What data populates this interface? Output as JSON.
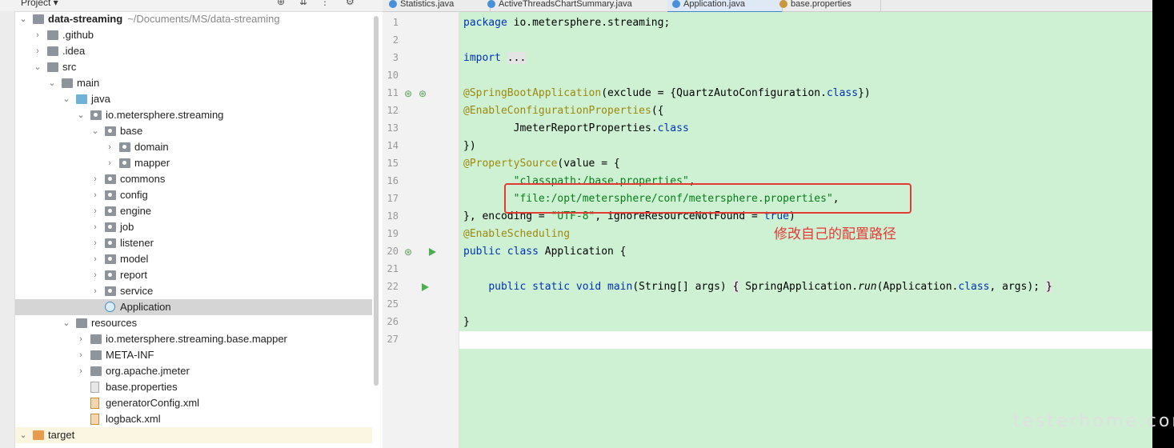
{
  "project_bar": {
    "label": "Project ▾"
  },
  "tree": [
    {
      "label": "data-streaming",
      "sub": "~/Documents/MS/data-streaming",
      "depth": 0,
      "arrow": "open",
      "icon": "folder",
      "bold": true
    },
    {
      "label": ".github",
      "depth": 1,
      "arrow": "closed",
      "icon": "folder"
    },
    {
      "label": ".idea",
      "depth": 1,
      "arrow": "closed",
      "icon": "folder"
    },
    {
      "label": "src",
      "depth": 1,
      "arrow": "open",
      "icon": "folder"
    },
    {
      "label": "main",
      "depth": 2,
      "arrow": "open",
      "icon": "folder"
    },
    {
      "label": "java",
      "depth": 3,
      "arrow": "open",
      "icon": "folder-blue"
    },
    {
      "label": "io.metersphere.streaming",
      "depth": 4,
      "arrow": "open",
      "icon": "package"
    },
    {
      "label": "base",
      "depth": 5,
      "arrow": "open",
      "icon": "package"
    },
    {
      "label": "domain",
      "depth": 6,
      "arrow": "closed",
      "icon": "package"
    },
    {
      "label": "mapper",
      "depth": 6,
      "arrow": "closed",
      "icon": "package"
    },
    {
      "label": "commons",
      "depth": 5,
      "arrow": "closed",
      "icon": "package"
    },
    {
      "label": "config",
      "depth": 5,
      "arrow": "closed",
      "icon": "package"
    },
    {
      "label": "engine",
      "depth": 5,
      "arrow": "closed",
      "icon": "package"
    },
    {
      "label": "job",
      "depth": 5,
      "arrow": "closed",
      "icon": "package"
    },
    {
      "label": "listener",
      "depth": 5,
      "arrow": "closed",
      "icon": "package"
    },
    {
      "label": "model",
      "depth": 5,
      "arrow": "closed",
      "icon": "package"
    },
    {
      "label": "report",
      "depth": 5,
      "arrow": "closed",
      "icon": "package"
    },
    {
      "label": "service",
      "depth": 5,
      "arrow": "closed",
      "icon": "package"
    },
    {
      "label": "Application",
      "depth": 5,
      "arrow": "none",
      "icon": "class",
      "selected": true
    },
    {
      "label": "resources",
      "depth": 3,
      "arrow": "open",
      "icon": "folder"
    },
    {
      "label": "io.metersphere.streaming.base.mapper",
      "depth": 4,
      "arrow": "closed",
      "icon": "folder"
    },
    {
      "label": "META-INF",
      "depth": 4,
      "arrow": "closed",
      "icon": "folder"
    },
    {
      "label": "org.apache.jmeter",
      "depth": 4,
      "arrow": "closed",
      "icon": "folder"
    },
    {
      "label": "base.properties",
      "depth": 4,
      "arrow": "none",
      "icon": "file"
    },
    {
      "label": "generatorConfig.xml",
      "depth": 4,
      "arrow": "none",
      "icon": "xml"
    },
    {
      "label": "logback.xml",
      "depth": 4,
      "arrow": "none",
      "icon": "xml"
    },
    {
      "label": "target",
      "depth": 0,
      "arrow": "open",
      "icon": "folder-orange",
      "target": true
    }
  ],
  "tabs": [
    {
      "label": "Statistics.java",
      "color": "#4a90d9"
    },
    {
      "label": "ActiveThreadsChartSummary.java",
      "color": "#4a90d9"
    },
    {
      "label": "Application.java",
      "color": "#4a90d9",
      "active": true
    },
    {
      "label": "base.properties",
      "color": "#c8963c"
    }
  ],
  "line_numbers": [
    "1",
    "2",
    "3",
    "10",
    "11",
    "12",
    "13",
    "14",
    "15",
    "16",
    "17",
    "18",
    "19",
    "20",
    "21",
    "22",
    "25",
    "26",
    "27"
  ],
  "code": [
    [
      {
        "t": "package",
        "c": "kw"
      },
      {
        "t": " io.metersphere.streaming;"
      }
    ],
    [],
    [
      {
        "t": "import",
        "c": "kw"
      },
      {
        "t": " "
      },
      {
        "t": "...",
        "c": "fold"
      }
    ],
    [],
    [
      {
        "t": "@SpringBootApplication",
        "c": "an"
      },
      {
        "t": "(exclude = {QuartzAutoConfiguration."
      },
      {
        "t": "class",
        "c": "kw"
      },
      {
        "t": "})"
      }
    ],
    [
      {
        "t": "@EnableConfigurationProperties",
        "c": "an"
      },
      {
        "t": "({"
      }
    ],
    [
      {
        "t": "        JmeterReportProperties."
      },
      {
        "t": "class",
        "c": "kw"
      }
    ],
    [
      {
        "t": "})"
      }
    ],
    [
      {
        "t": "@PropertySource",
        "c": "an"
      },
      {
        "t": "(value = {"
      }
    ],
    [
      {
        "t": "        "
      },
      {
        "t": "\"classpath:/base.properties\"",
        "c": "str"
      },
      {
        "t": ","
      }
    ],
    [
      {
        "t": "        "
      },
      {
        "t": "\"file:/opt/metersphere/conf/metersphere.properties\"",
        "c": "str"
      },
      {
        "t": ","
      }
    ],
    [
      {
        "t": "}, encoding = "
      },
      {
        "t": "\"UTF-8\"",
        "c": "str"
      },
      {
        "t": ", ignoreResourceNotFound = "
      },
      {
        "t": "true",
        "c": "kw"
      },
      {
        "t": ")"
      }
    ],
    [
      {
        "t": "@EnableScheduling",
        "c": "an"
      }
    ],
    [
      {
        "t": "public class",
        "c": "kw"
      },
      {
        "t": " Application {"
      }
    ],
    [],
    [
      {
        "t": "    "
      },
      {
        "t": "public static void",
        "c": "kw"
      },
      {
        "t": " "
      },
      {
        "t": "main",
        "c": "kw"
      },
      {
        "t": "(String[] args) "
      },
      {
        "t": "{",
        "c": "fold"
      },
      {
        "t": " SpringApplication."
      },
      {
        "t": "run",
        "c": "it"
      },
      {
        "t": "(Application."
      },
      {
        "t": "class",
        "c": "kw"
      },
      {
        "t": ", args); "
      },
      {
        "t": "}",
        "c": "fold"
      }
    ],
    [],
    [
      {
        "t": "}"
      }
    ],
    []
  ],
  "annotation": {
    "note": "修改自己的配置路径"
  },
  "watermark": {
    "text": "testerhome.com"
  }
}
